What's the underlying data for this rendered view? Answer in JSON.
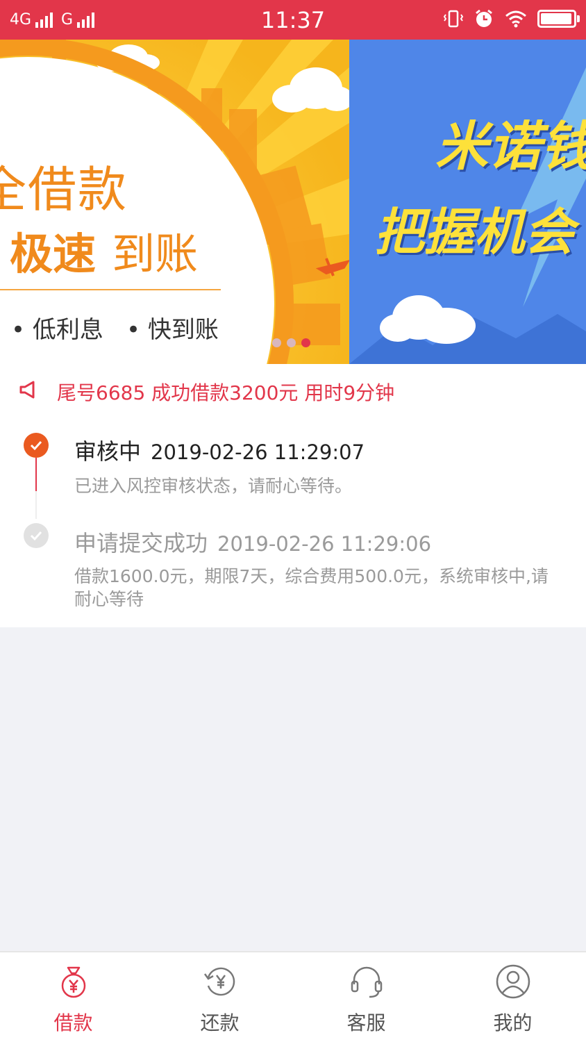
{
  "status_bar": {
    "network_1": "4G",
    "network_2": "G",
    "time": "11:37",
    "battery_level": 0.95,
    "icons": [
      "vibrate-icon",
      "alarm-icon",
      "wifi-icon",
      "battery-icon"
    ]
  },
  "banner": {
    "slide_1": {
      "line1": "全借款",
      "line2_bold": "极速",
      "line2_light": "到账",
      "bullet_1": "• 低利息",
      "bullet_2": "• 快到账"
    },
    "slide_2": {
      "line1": "米诺钱",
      "line2": "把握机会"
    },
    "dot_count": 3,
    "active_dot_index": 2
  },
  "notice": {
    "icon": "megaphone-icon",
    "text": "尾号6685 成功借款3200元 用时9分钟"
  },
  "timeline": [
    {
      "title": "审核中",
      "time": "2019-02-26 11:29:07",
      "desc": "已进入风控审核状态，请耐心等待。",
      "status": "current"
    },
    {
      "title": "申请提交成功",
      "time": "2019-02-26 11:29:06",
      "desc": "借款1600.0元，期限7天，综合费用500.0元，系统审核中,请耐心等待",
      "status": "done"
    }
  ],
  "tabs": [
    {
      "label": "借款",
      "icon": "money-bag-icon",
      "active": true
    },
    {
      "label": "还款",
      "icon": "repay-icon",
      "active": false
    },
    {
      "label": "客服",
      "icon": "headset-icon",
      "active": false
    },
    {
      "label": "我的",
      "icon": "user-icon",
      "active": false
    }
  ],
  "colors": {
    "brand": "#e2364a",
    "progress_orange": "#ea5a20",
    "banner_yellow": "#f7c623",
    "banner_blue": "#4f86e8"
  }
}
